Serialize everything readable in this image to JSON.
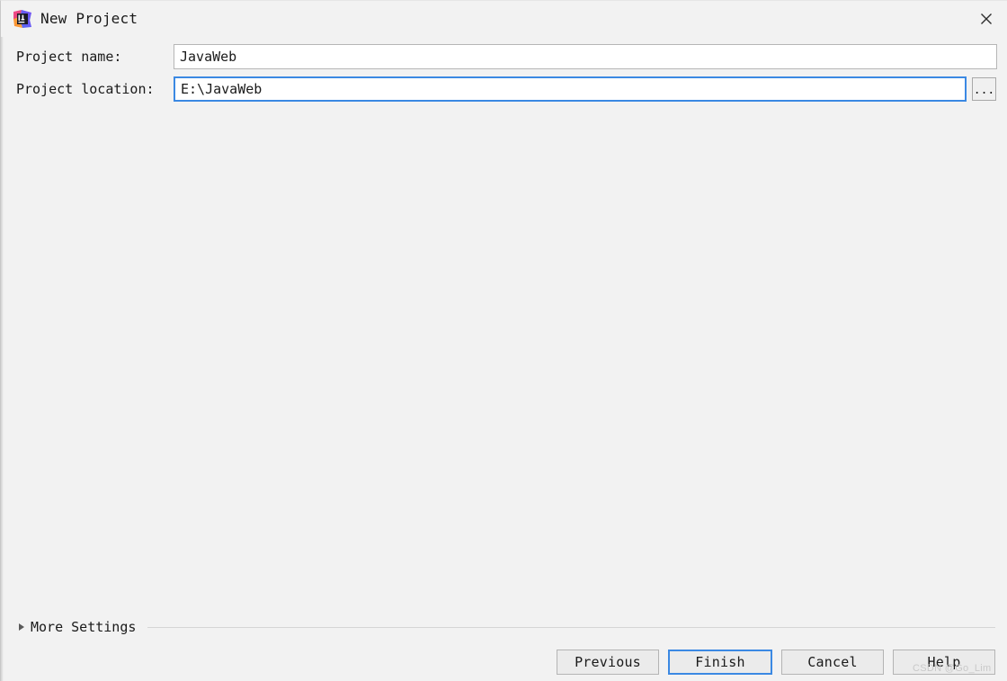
{
  "window": {
    "title": "New Project",
    "icon": "intellij-idea-icon",
    "close_icon": "close-icon",
    "background_color": "#f2f2f2"
  },
  "form": {
    "fields": [
      {
        "label": "Project name:",
        "value": "JavaWeb",
        "placeholder": "",
        "focused": false,
        "border_color": "#b6b6b6"
      },
      {
        "label": "Project location:",
        "value": "E:\\JavaWeb",
        "placeholder": "",
        "focused": true,
        "border_color": "#3b89e3"
      }
    ],
    "browse_button_label": "..."
  },
  "more_settings": {
    "label": "More Settings",
    "expanded": false,
    "arrow_icon": "chevron-right-icon"
  },
  "buttons": [
    {
      "label": "Previous",
      "default": false
    },
    {
      "label": "Finish",
      "default": true
    },
    {
      "label": "Cancel",
      "default": false
    },
    {
      "label": "Help",
      "default": false
    }
  ],
  "watermark": {
    "text": "CSDN @Go_Lim"
  },
  "colors": {
    "accent": "#3b89e3",
    "background": "#f2f2f2",
    "field_background": "#ffffff",
    "button_background": "#ebebeb",
    "text": "#1a1a1a"
  }
}
